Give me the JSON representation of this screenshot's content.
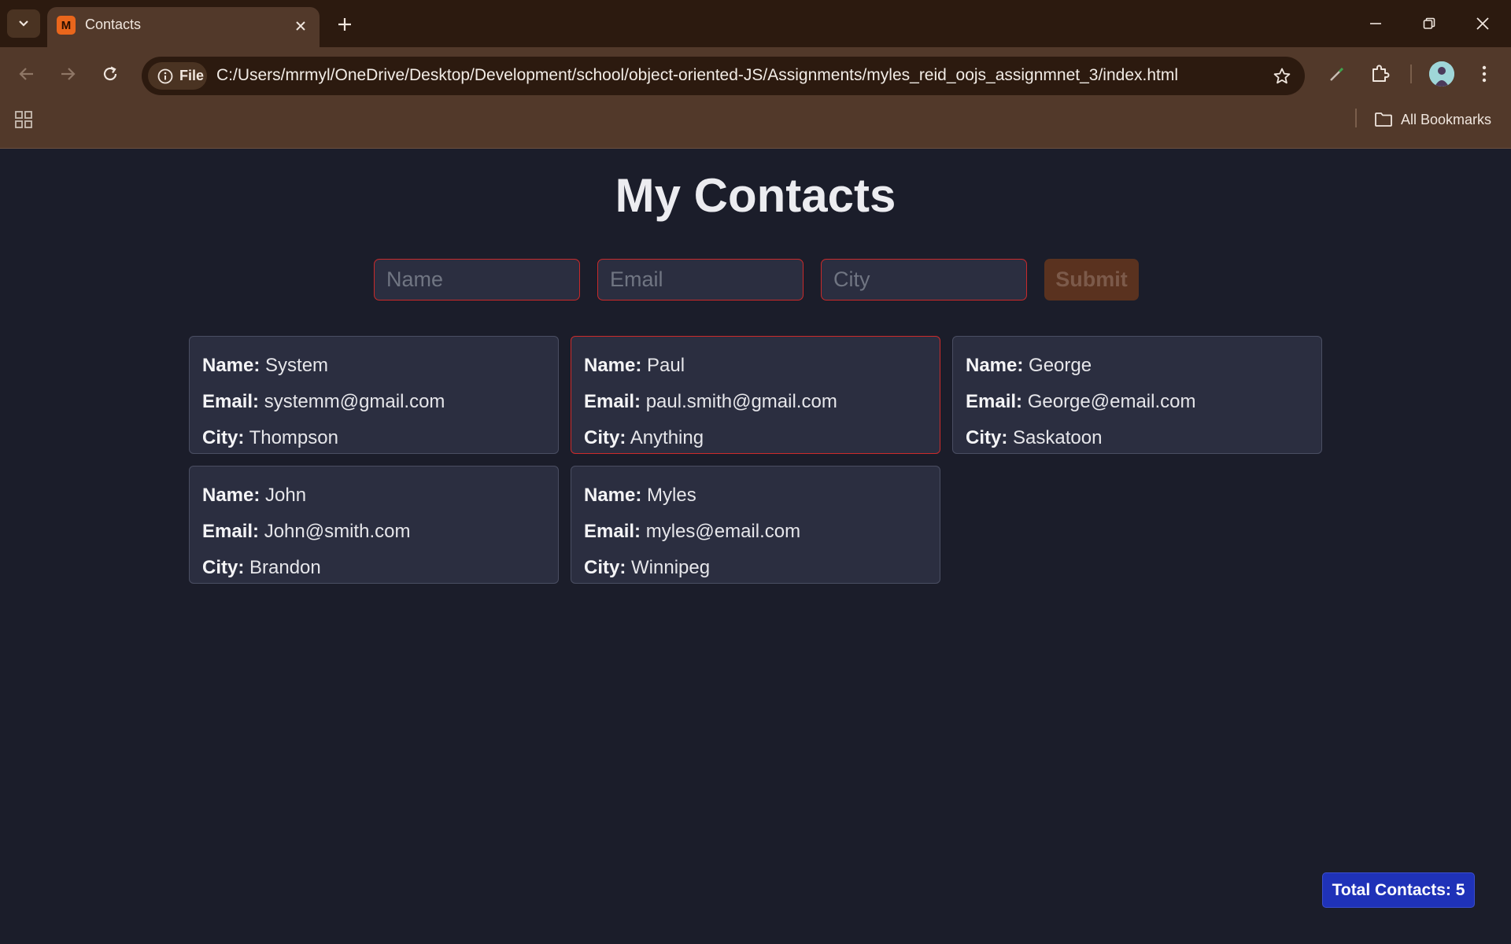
{
  "browser": {
    "tab": {
      "title": "Contacts",
      "favicon_letter": "M"
    },
    "address": {
      "chip_label": "File",
      "url": "C:/Users/mrmyl/OneDrive/Desktop/Development/school/object-oriented-JS/Assignments/myles_reid_oojs_assignmnet_3/index.html"
    },
    "bookmarks": {
      "all_label": "All Bookmarks"
    },
    "colors": {
      "frame": "#2c1a0f",
      "toolbar": "#52392a"
    }
  },
  "page": {
    "title": "My Contacts",
    "form": {
      "name_placeholder": "Name",
      "email_placeholder": "Email",
      "city_placeholder": "City",
      "submit_label": "Submit"
    },
    "labels": {
      "name": "Name:",
      "email": "Email:",
      "city": "City:"
    },
    "contacts": [
      {
        "name": "System",
        "email": "systemm@gmail.com",
        "city": "Thompson"
      },
      {
        "name": "Paul",
        "email": "paul.smith@gmail.com",
        "city": "Anything",
        "highlighted": true
      },
      {
        "name": "George",
        "email": "George@email.com",
        "city": "Saskatoon"
      },
      {
        "name": "John",
        "email": "John@smith.com",
        "city": "Brandon"
      },
      {
        "name": "Myles",
        "email": "myles@email.com",
        "city": "Winnipeg"
      }
    ],
    "total_label": "Total Contacts: 5",
    "colors": {
      "background": "#1b1d2a",
      "card": "#2b2e40",
      "error_border": "#cc2b2b",
      "badge": "#1f32b8"
    }
  }
}
